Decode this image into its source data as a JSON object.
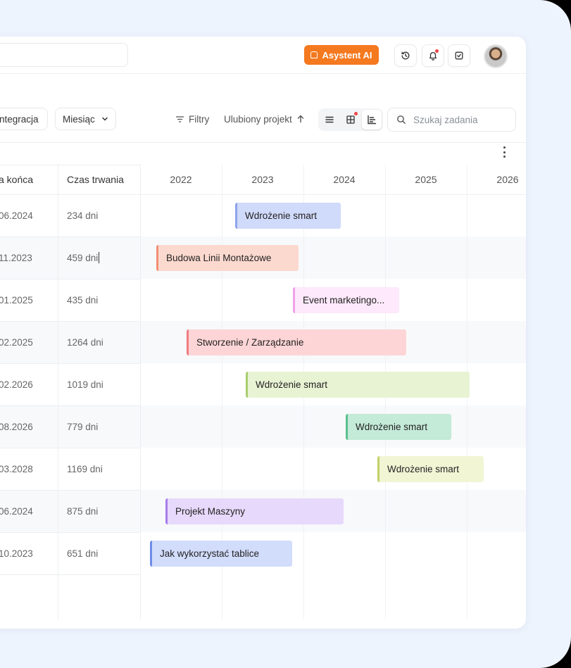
{
  "header": {
    "ai_button_label": "Asystent AI"
  },
  "toolbar": {
    "integration_label": "ntegracja",
    "period_label": "Miesiąc",
    "filters_label": "Filtry",
    "sort_label": "Ulubiony projekt",
    "search_placeholder": "Szukaj zadania"
  },
  "columns": {
    "end_date": "a końca",
    "duration": "Czas trwania"
  },
  "years": [
    "2022",
    "2023",
    "2024",
    "2025",
    "2026"
  ],
  "rows": [
    {
      "end_date": "06.2024",
      "duration": "234 dni",
      "task": "Wdrożenie smart"
    },
    {
      "end_date": "11.2023",
      "duration": "459 dni",
      "task": "Budowa Linii Montażowe"
    },
    {
      "end_date": "01.2025",
      "duration": "435 dni",
      "task": "Event marketingo..."
    },
    {
      "end_date": "02.2025",
      "duration": "1264 dni",
      "task": "Stworzenie / Zarządzanie"
    },
    {
      "end_date": "02.2026",
      "duration": "1019 dni",
      "task": "Wdrożenie smart"
    },
    {
      "end_date": "08.2026",
      "duration": "779 dni",
      "task": "Wdrożenie smart"
    },
    {
      "end_date": "03.2028",
      "duration": "1169 dni",
      "task": "Wdrożenie smart"
    },
    {
      "end_date": "06.2024",
      "duration": "875 dni",
      "task": "Projekt Maszyny"
    },
    {
      "end_date": "10.2023",
      "duration": "651 dni",
      "task": "Jak wykorzystać tablice"
    }
  ],
  "colors": {
    "accent": "#f4791f",
    "bars": [
      {
        "fill": "#d0dafa",
        "edge": "#8ea3ea"
      },
      {
        "fill": "#fcd9cf",
        "edge": "#f28f73"
      },
      {
        "fill": "#fde9fb",
        "edge": "#ef9fe8"
      },
      {
        "fill": "#fed5d6",
        "edge": "#f07c80"
      },
      {
        "fill": "#e8f3d3",
        "edge": "#a9cd6e"
      },
      {
        "fill": "#c4ead8",
        "edge": "#5cc08f"
      },
      {
        "fill": "#f1f5d4",
        "edge": "#c3d06a"
      },
      {
        "fill": "#e7d9fb",
        "edge": "#a57ee9"
      },
      {
        "fill": "#d2dcfb",
        "edge": "#6f8de8"
      }
    ]
  }
}
